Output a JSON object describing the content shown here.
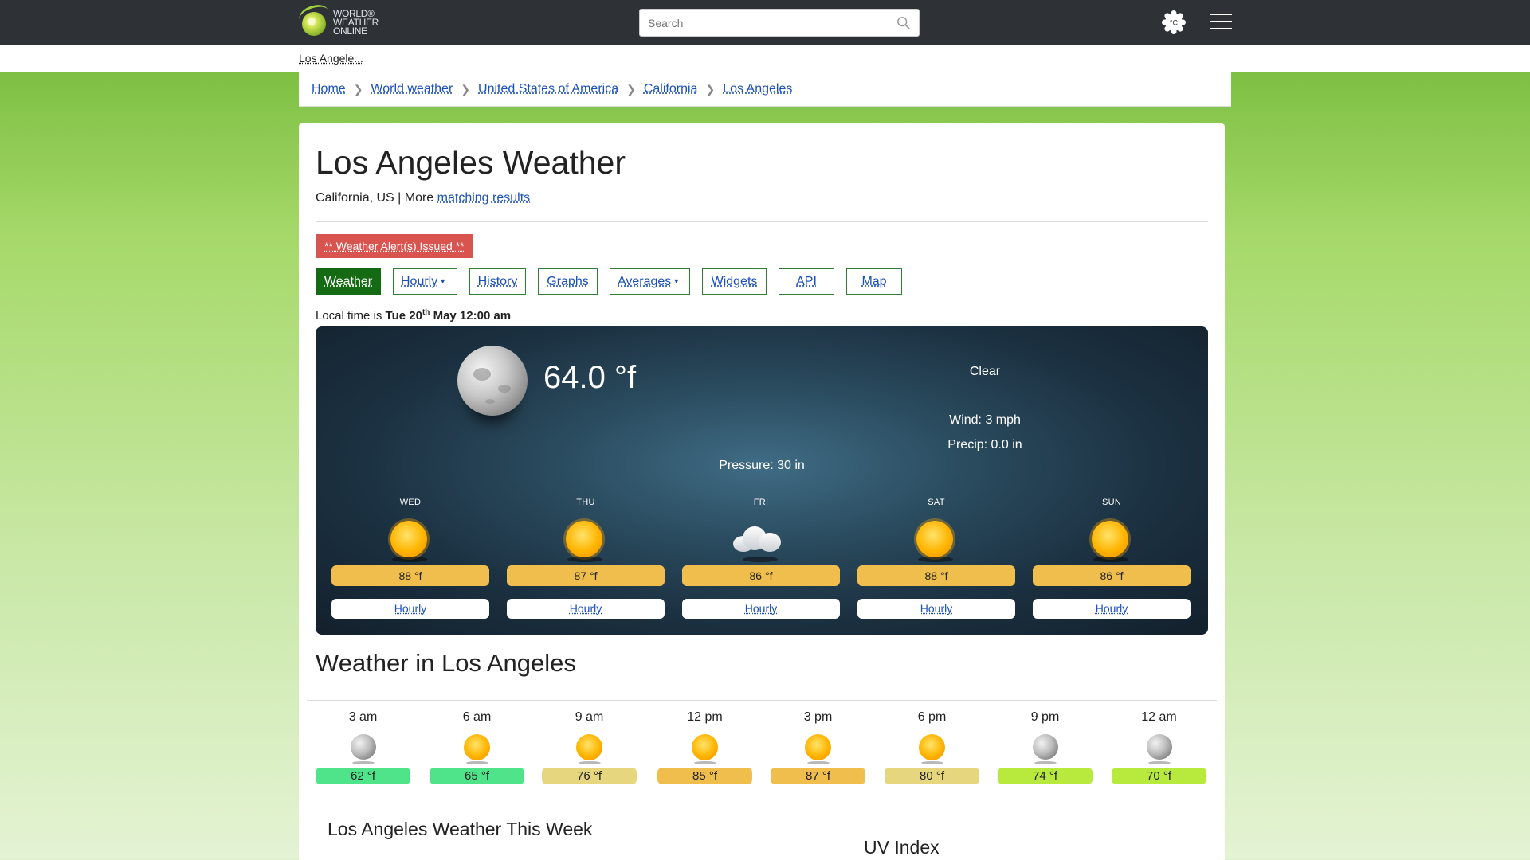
{
  "header": {
    "logo_text": [
      "WORLD®",
      "WEATHER",
      "ONLINE"
    ],
    "search_placeholder": "Search",
    "unit_toggle_label": "°C"
  },
  "location_strip": "Los Angele...",
  "breadcrumb": [
    "Home",
    "World weather",
    "United States of America",
    "California",
    "Los Angeles"
  ],
  "page": {
    "title": "Los Angeles Weather",
    "subtitle_prefix": "California, US | More ",
    "subtitle_link": "matching results",
    "alert": "** Weather Alert(s) Issued **"
  },
  "tabs": [
    "Weather",
    "Hourly",
    "History",
    "Graphs",
    "Averages",
    "Widgets",
    "API",
    "Map"
  ],
  "local_time": {
    "prefix": "Local time is ",
    "day": "Tue 20",
    "sup": "th",
    "rest": " May 12:00 am"
  },
  "current": {
    "icon": "moon-icon",
    "temperature": "64.0 °f",
    "condition": "Clear",
    "wind": "Wind: 3 mph",
    "precip": "Precip: 0.0 in",
    "pressure": "Pressure: 30 in"
  },
  "forecast": [
    {
      "day": "WED",
      "icon": "sun-icon",
      "temp": "88 °f",
      "link": "Hourly"
    },
    {
      "day": "THU",
      "icon": "sun-icon",
      "temp": "87 °f",
      "link": "Hourly"
    },
    {
      "day": "FRI",
      "icon": "cloud-icon",
      "temp": "86 °f",
      "link": "Hourly"
    },
    {
      "day": "SAT",
      "icon": "sun-icon",
      "temp": "88 °f",
      "link": "Hourly"
    },
    {
      "day": "SUN",
      "icon": "sun-icon",
      "temp": "86 °f",
      "link": "Hourly"
    }
  ],
  "section_title": "Weather in Los Angeles",
  "hourly": [
    {
      "time": "3 am",
      "icon": "moon-icon",
      "temp": "62 °f",
      "color": "#4fe38a"
    },
    {
      "time": "6 am",
      "icon": "sun-icon",
      "temp": "65 °f",
      "color": "#4fe38a"
    },
    {
      "time": "9 am",
      "icon": "sun-icon",
      "temp": "76 °f",
      "color": "#e6d77e"
    },
    {
      "time": "12 pm",
      "icon": "sun-icon",
      "temp": "85 °f",
      "color": "#f0be4d"
    },
    {
      "time": "3 pm",
      "icon": "sun-icon",
      "temp": "87 °f",
      "color": "#f0be4d"
    },
    {
      "time": "6 pm",
      "icon": "sun-icon",
      "temp": "80 °f",
      "color": "#e6d77e"
    },
    {
      "time": "9 pm",
      "icon": "moon-icon",
      "temp": "74 °f",
      "color": "#b7ea3c"
    },
    {
      "time": "12 am",
      "icon": "moon-icon",
      "temp": "70 °f",
      "color": "#b7ea3c"
    }
  ],
  "week_title": "Los Angeles Weather This Week",
  "uv_title": "UV Index"
}
